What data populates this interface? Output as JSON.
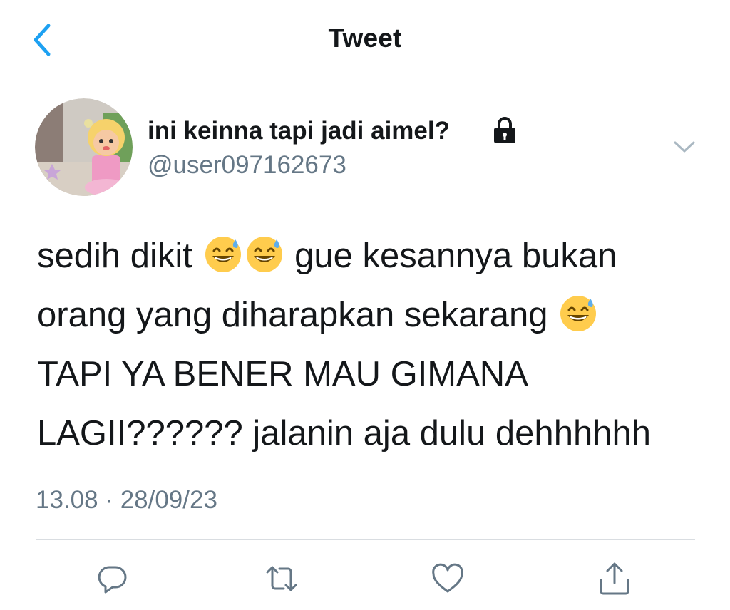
{
  "header": {
    "title": "Tweet",
    "back_icon": "chevron-left-icon",
    "accent_color": "#1da1f2"
  },
  "tweet": {
    "author": {
      "name": "ini keinna tapi jadi aimel?",
      "handle": "@user097162673",
      "protected_icon": "lock-icon"
    },
    "text_lines": [
      {
        "parts": [
          "sedih dikit ",
          " gue kesannya bukan"
        ]
      },
      {
        "parts": [
          "orang yang diharapkan sekarang "
        ]
      },
      {
        "parts": [
          "TAPI YA BENER MAU GIMANA"
        ]
      },
      {
        "parts": [
          "LAGII?????? jalanin aja dulu dehhhhhh"
        ]
      }
    ],
    "emoji": "grinning-face-with-sweat",
    "timestamp": "13.08 · 28/09/23"
  },
  "actions": [
    {
      "name": "reply",
      "icon": "reply-icon"
    },
    {
      "name": "retweet",
      "icon": "retweet-icon"
    },
    {
      "name": "like",
      "icon": "heart-icon"
    },
    {
      "name": "share",
      "icon": "share-icon"
    }
  ],
  "colors": {
    "text": "#14171a",
    "secondary": "#657786",
    "divider": "#d9dde1",
    "icon": "#657786"
  }
}
